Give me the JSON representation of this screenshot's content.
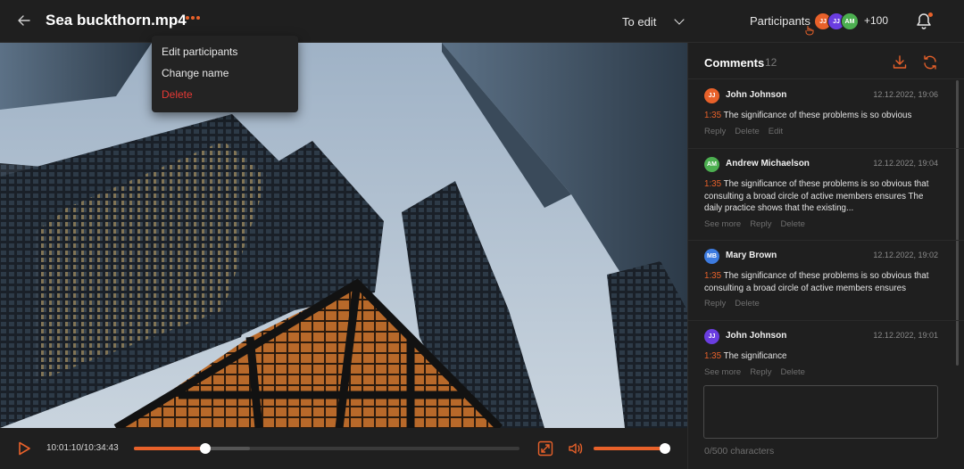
{
  "header": {
    "title": "Sea buckthorn.mp4",
    "status_value": "To edit",
    "participants_label": "Participants",
    "participants": [
      {
        "initials": "JJ",
        "color": "#e8612a"
      },
      {
        "initials": "JJ",
        "color": "#6a3de0"
      },
      {
        "initials": "AM",
        "color": "#4caf50"
      }
    ],
    "participants_more": "+100"
  },
  "menu": {
    "items": [
      {
        "label": "Edit participants"
      },
      {
        "label": "Change name"
      },
      {
        "label": "Delete"
      }
    ]
  },
  "player": {
    "timecode": "10:01:10/10:34:43",
    "progress": 0.185,
    "buffered": 0.3,
    "volume": 0.98
  },
  "comments_panel": {
    "title": "Comments",
    "count": "12",
    "input_placeholder": "",
    "char_counter": "0/500 characters",
    "comments": [
      {
        "initials": "JJ",
        "avatar_color": "#e8612a",
        "author": "John Johnson",
        "date": "12.12.2022, 19:06",
        "time": "1:35",
        "text": "The significance of these problems is so obvious",
        "actions": [
          "Reply",
          "Delete",
          "Edit"
        ]
      },
      {
        "initials": "AM",
        "avatar_color": "#4caf50",
        "author": "Andrew Michaelson",
        "date": "12.12.2022, 19:04",
        "time": "1:35",
        "text": "The significance of these problems is so obvious that consulting a broad circle of active members ensures The daily practice shows that the existing...",
        "actions": [
          "See more",
          "Reply",
          "Delete"
        ]
      },
      {
        "initials": "MB",
        "avatar_color": "#3d7be0",
        "author": "Mary Brown",
        "date": "12.12.2022, 19:02",
        "time": "1:35",
        "text": "The significance of these problems is so obvious that consulting a broad circle of active members ensures",
        "actions": [
          "Reply",
          "Delete"
        ]
      },
      {
        "initials": "JJ",
        "avatar_color": "#6a3de0",
        "author": "John Johnson",
        "date": "12.12.2022, 19:01",
        "time": "1:35",
        "text": "The significance",
        "actions": [
          "See more",
          "Reply",
          "Delete"
        ]
      }
    ]
  },
  "colors": {
    "accent": "#e8612a",
    "danger": "#e53935",
    "panel_bg": "#1f1f1f"
  }
}
